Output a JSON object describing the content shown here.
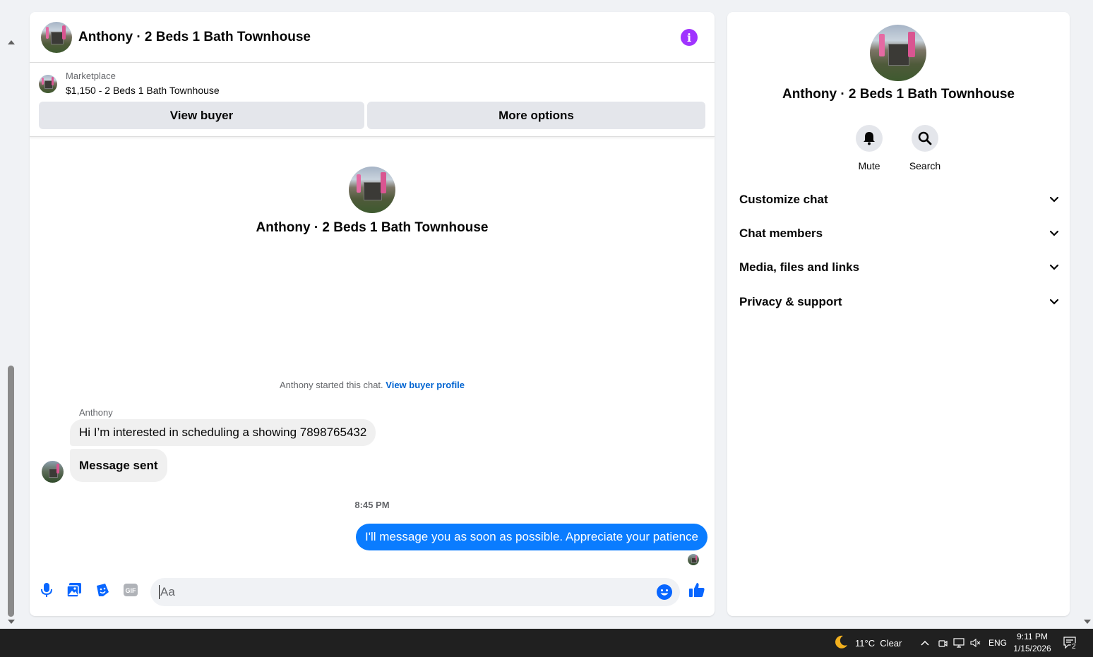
{
  "chat": {
    "header_title": "Anthony · 2 Beds 1 Bath Townhouse",
    "marketplace_label": "Marketplace",
    "listing_title": "$1,150 - 2 Beds 1 Bath Townhouse",
    "view_buyer_label": "View buyer",
    "more_options_label": "More options",
    "intro_name": "Anthony · 2 Beds 1 Bath Townhouse",
    "started_text": "Anthony started this chat.",
    "view_profile_link": "View buyer profile",
    "sender_name": "Anthony",
    "messages_in": [
      "Hi I’m interested in scheduling a showing 7898765432",
      "Message sent"
    ],
    "timestamp": "8:45 PM",
    "message_out": "I'll message you as soon as possible. Appreciate your patience",
    "composer_placeholder": "Aa",
    "gif_label": "GIF"
  },
  "side": {
    "name": "Anthony · 2 Beds 1 Bath Townhouse",
    "mute_label": "Mute",
    "search_label": "Search",
    "sections": [
      "Customize chat",
      "Chat members",
      "Media, files and links",
      "Privacy & support"
    ]
  },
  "taskbar": {
    "weather": "11°C  Clear",
    "language": "ENG",
    "time": "9:11 PM",
    "date": "1/15/2026",
    "notification_count": "2"
  },
  "colors": {
    "accent_blue": "#0a7cff",
    "info_purple": "#a033ff",
    "icon_blue": "#0866ff"
  }
}
